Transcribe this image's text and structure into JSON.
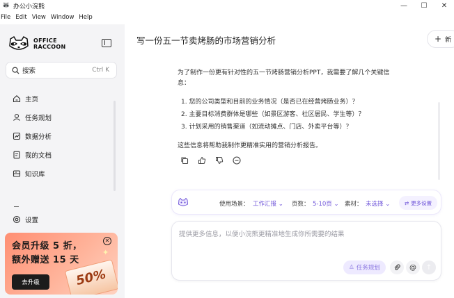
{
  "window": {
    "title": "办公小浣熊",
    "controls": {
      "minimize": "—",
      "maximize": "☐",
      "close": "✕"
    }
  },
  "menu": [
    "File",
    "Edit",
    "View",
    "Window",
    "Help"
  ],
  "sidebar": {
    "logo": {
      "line1": "OFFICE",
      "line2": "RACCOON"
    },
    "search": {
      "label": "搜索",
      "shortcut": "Ctrl K"
    },
    "items": [
      {
        "label": "主页",
        "icon": "home-icon"
      },
      {
        "label": "任务规划",
        "icon": "task-planning-icon"
      },
      {
        "label": "数据分析",
        "icon": "data-analysis-icon"
      },
      {
        "label": "我的文档",
        "icon": "documents-icon"
      },
      {
        "label": "知识库",
        "icon": "knowledge-base-icon"
      }
    ],
    "settings": {
      "label": "设置",
      "icon": "settings-icon"
    },
    "promo": {
      "line1": "会员升级 5 折，",
      "line2": "额外赠送 15 天",
      "button": "去升级",
      "badge": "50%",
      "colors": {
        "start": "#ff8f73",
        "end": "#ffd2c1"
      }
    }
  },
  "main": {
    "title": "写一份五一节卖烤肠的市场营销分析",
    "new_button": "新",
    "message": {
      "intro_line1": "为了制作一份更有针对性的五一节烤肠营销分析PPT，我需要了解几个关键信",
      "intro_line2": "息：",
      "questions": [
        "1.  您的公司类型和目前的业务情况（是否已在经营烤肠业务）？",
        "2.  主要目标消费群体是哪些（如景区游客、社区居民、学生等）？",
        "3.  计划采用的销售渠道（如流动摊点、门店、外卖平台等）？"
      ],
      "closing": "这些信息将帮助我制作更精准实用的营销分析报告。"
    },
    "options": {
      "scene_label": "使用场景：",
      "scene_value": "工作汇报",
      "pages_label": "页数：",
      "pages_value": "5-10页",
      "material_label": "素材：",
      "material_value": "未选择",
      "more_settings": "更多设置"
    },
    "input": {
      "placeholder": "提供更多信息，以便小浣熊更精准地生成你所需要的结果",
      "task_button": "任务规划",
      "attach_icon": "paperclip-icon",
      "mention_icon": "at-icon",
      "send_icon": "send-arrow-icon"
    },
    "accent_color": "#6f55d9"
  }
}
